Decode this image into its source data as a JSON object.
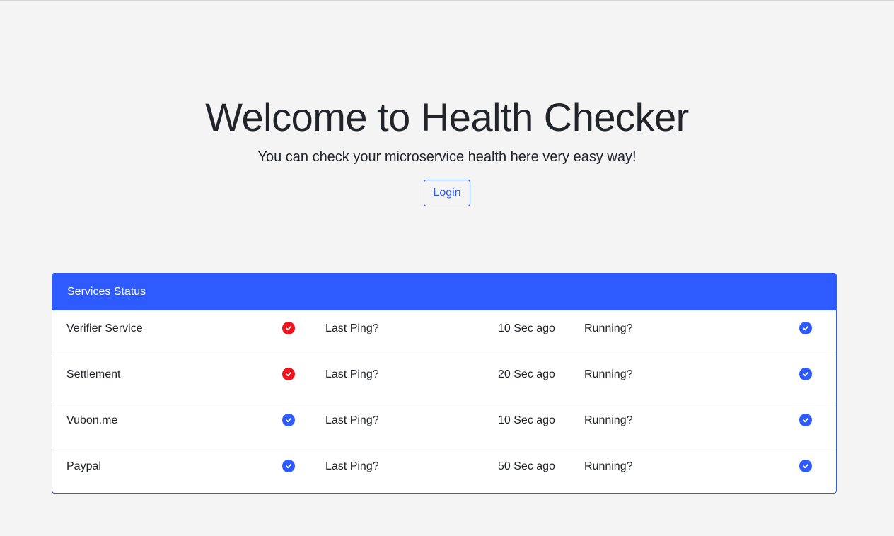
{
  "hero": {
    "title": "Welcome to Health Checker",
    "subtitle": "You can check your microservice health here very easy way!",
    "login_label": "Login"
  },
  "card": {
    "header": "Services Status",
    "rows": [
      {
        "name": "Verifier Service",
        "status": "error",
        "ping_label": "Last Ping?",
        "ping_value": "10 Sec ago",
        "running_label": "Running?",
        "running": "ok"
      },
      {
        "name": "Settlement",
        "status": "error",
        "ping_label": "Last Ping?",
        "ping_value": "20 Sec ago",
        "running_label": "Running?",
        "running": "ok"
      },
      {
        "name": "Vubon.me",
        "status": "ok",
        "ping_label": "Last Ping?",
        "ping_value": "10 Sec ago",
        "running_label": "Running?",
        "running": "ok"
      },
      {
        "name": "Paypal",
        "status": "ok",
        "ping_label": "Last Ping?",
        "ping_value": "50 Sec ago",
        "running_label": "Running?",
        "running": "ok"
      }
    ]
  },
  "colors": {
    "accent": "#2e5bff",
    "ok": "#2e5bff",
    "error": "#f2121b",
    "background": "#f4f4f4"
  },
  "icons": {
    "ok": "check-circle-icon",
    "error": "check-circle-icon"
  }
}
